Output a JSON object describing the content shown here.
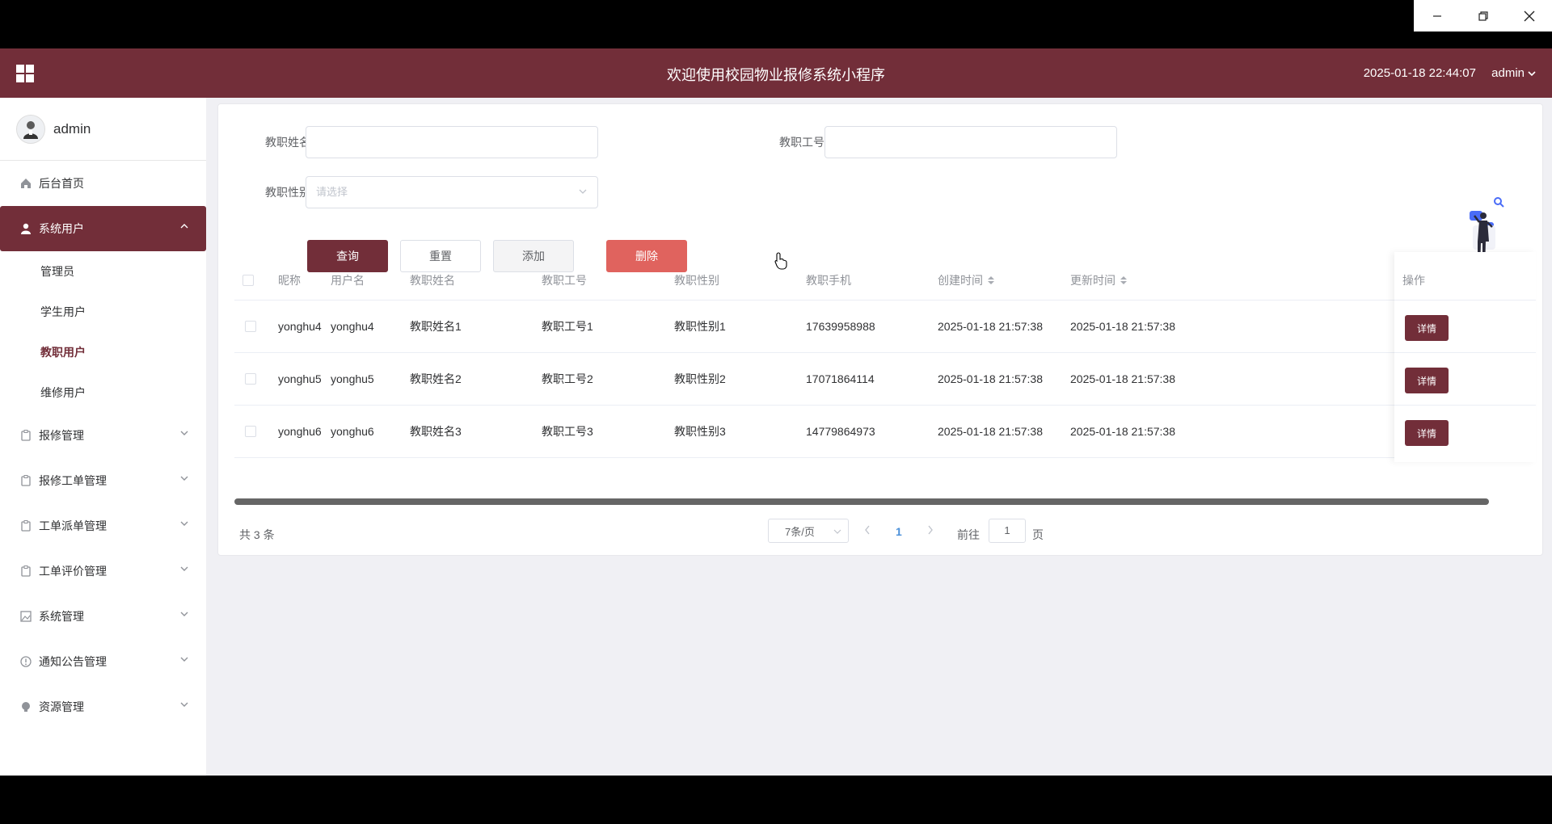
{
  "window": {
    "minimize": "—",
    "restore": "❐",
    "close": "✕"
  },
  "header": {
    "title": "欢迎使用校园物业报修系统小程序",
    "datetime": "2025-01-18 22:44:07",
    "user": "admin"
  },
  "sidebar": {
    "username": "admin",
    "items": [
      {
        "label": "后台首页",
        "icon": "home-icon"
      },
      {
        "label": "系统用户",
        "icon": "user-icon",
        "active": true,
        "children": [
          "管理员",
          "学生用户",
          "教职用户",
          "维修用户"
        ],
        "selected_child": "教职用户"
      },
      {
        "label": "报修管理",
        "icon": "clipboard-icon"
      },
      {
        "label": "报修工单管理",
        "icon": "clipboard-icon"
      },
      {
        "label": "工单派单管理",
        "icon": "clipboard-icon"
      },
      {
        "label": "工单评价管理",
        "icon": "clipboard-icon"
      },
      {
        "label": "系统管理",
        "icon": "image-icon"
      },
      {
        "label": "通知公告管理",
        "icon": "info-icon"
      },
      {
        "label": "资源管理",
        "icon": "bulb-icon"
      }
    ]
  },
  "search": {
    "name_label": "教职姓名",
    "name_value": "",
    "id_label": "教职工号",
    "id_value": "",
    "gender_label": "教职性别",
    "gender_placeholder": "请选择",
    "query": "查询",
    "reset": "重置",
    "add": "添加",
    "delete": "删除"
  },
  "table": {
    "columns": [
      "昵称",
      "用户名",
      "教职姓名",
      "教职工号",
      "教职性别",
      "教职手机",
      "创建时间",
      "更新时间",
      "操作"
    ],
    "rows": [
      [
        "yonghu4",
        "yonghu4",
        "教职姓名1",
        "教职工号1",
        "教职性别1",
        "17639958988",
        "2025-01-18 21:57:38",
        "2025-01-18 21:57:38"
      ],
      [
        "yonghu5",
        "yonghu5",
        "教职姓名2",
        "教职工号2",
        "教职性别2",
        "17071864114",
        "2025-01-18 21:57:38",
        "2025-01-18 21:57:38"
      ],
      [
        "yonghu6",
        "yonghu6",
        "教职姓名3",
        "教职工号3",
        "教职性别3",
        "14779864973",
        "2025-01-18 21:57:38",
        "2025-01-18 21:57:38"
      ]
    ],
    "detail_label": "详情"
  },
  "pagination": {
    "total": "共 3 条",
    "page_size": "7条/页",
    "current": "1",
    "goto_label": "前往",
    "goto_value": "1",
    "goto_unit": "页"
  },
  "colors": {
    "primary": "#722e39",
    "danger": "#e0635e"
  }
}
